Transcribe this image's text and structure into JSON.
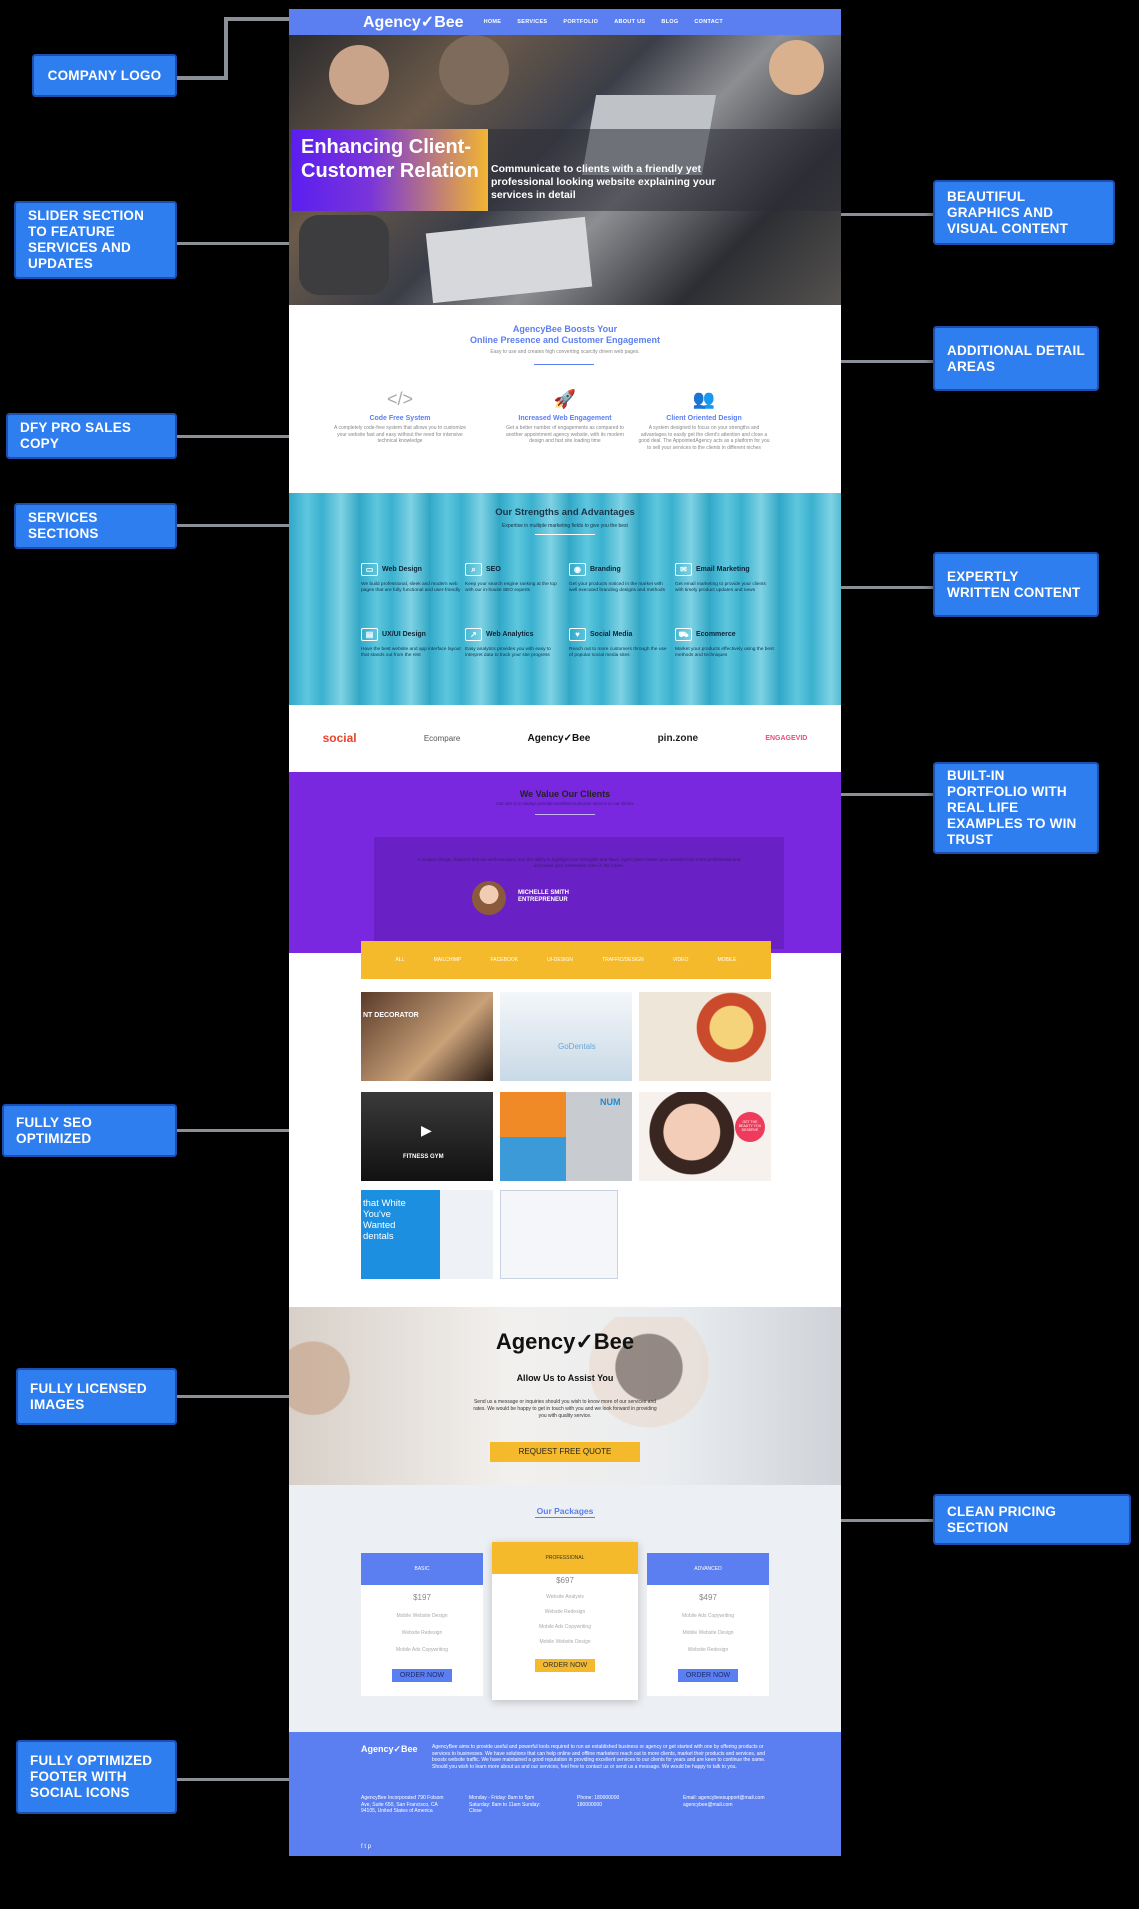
{
  "callouts": {
    "company_logo": "COMPANY LOGO",
    "slider": "SLIDER SECTION TO FEATURE SERVICES AND UPDATES",
    "dfy": "DFY PRO SALES COPY",
    "services": "SERVICES SECTIONS",
    "seo": "FULLY SEO OPTIMIZED",
    "images": "FULLY LICENSED IMAGES",
    "footer": "FULLY OPTIMIZED FOOTER WITH SOCIAL ICONS",
    "graphics": "BEAUTIFUL GRAPHICS AND VISUAL CONTENT",
    "detail": "ADDITIONAL DETAIL AREAS",
    "content": "EXPERTLY WRITTEN CONTENT",
    "portfolio": "BUILT-IN PORTFOLIO WITH REAL LIFE EXAMPLES TO WIN TRUST",
    "pricing": "CLEAN PRICING SECTION"
  },
  "nav": {
    "logo": "Agency✓Bee",
    "links": [
      "HOME",
      "SERVICES",
      "PORTFOLIO",
      "ABOUT US",
      "BLOG",
      "CONTACT"
    ]
  },
  "hero": {
    "title": "Enhancing Client-Customer Relation",
    "subtitle": "Communicate to clients with a friendly yet professional looking website explaining your services in detail"
  },
  "intro": {
    "title1": "AgencyBee Boosts Your",
    "title2": "Online Presence and Customer Engagement",
    "sub": "Easy to use and creates high converting scarcity driven web pages.",
    "features": [
      {
        "icon": "</>",
        "title": "Code Free System",
        "desc": "A completely code-free system that allows you to customize your website fast and easy without the need for intensive technical knowledge"
      },
      {
        "icon": "🚀",
        "title": "Increased Web Engagement",
        "desc": "Get a better number of engagements as compared to another appointment agency website, with its modern design and fast site loading time"
      },
      {
        "icon": "👥",
        "title": "Client Oriented Design",
        "desc": "A system designed to focus on your strengths and advantages to easily get the client's attention and close a good deal. The AppointedAgency acts as a platform for you to sell your services to the clients in different niches"
      }
    ]
  },
  "strengths": {
    "title": "Our Strengths and Advantages",
    "sub": "Expertise in multiple marketing fields to give you the best",
    "items": [
      {
        "title": "Web Design",
        "desc": "We build professional, sleek and modern web pages that are fully functional and user-friendly"
      },
      {
        "title": "SEO",
        "desc": "Keep your search engine ranking at the top with our in-house SEO experts"
      },
      {
        "title": "Branding",
        "desc": "Get your products noticed in the market with well executed branding designs and methods"
      },
      {
        "title": "Email Marketing",
        "desc": "Get email marketing to provide your clients with timely product updates and news"
      },
      {
        "title": "UX/UI Design",
        "desc": "Have the best website and app interface layout that stands out from the rest"
      },
      {
        "title": "Web Analytics",
        "desc": "Easy analytics provides you with easy to interpret data to track your site progress"
      },
      {
        "title": "Social Media",
        "desc": "Reach out to more customers through the use of popular social media sites"
      },
      {
        "title": "Ecommerce",
        "desc": "Market your products effectively using the best methods and techniques"
      }
    ]
  },
  "brands": [
    "social",
    "Ecompare",
    "Agency✓Bee",
    "pin.zone",
    "ENGAGEVID"
  ],
  "clients": {
    "title": "We Value Our Clients",
    "sub": "Our aim is to always provide excellent customer service to our clients",
    "quote": "A modern design, features that are well-executed, and the ability to highlight your strengths and flaws. AgencyBee makes your website look more professional and increases your conversion rates in the future.",
    "name": "MICHELLE SMITH",
    "role": "ENTREPRENEUR"
  },
  "portfolio": {
    "tabs": [
      "ALL",
      "MAILCHIMP",
      "FACEBOOK",
      "UI-DESIGN",
      "TRAFFIC/DESIGN",
      "VIDEO",
      "MOBILE"
    ],
    "thumbs": [
      "NT DECORATOR",
      "GoDentals",
      "",
      "FITNESS GYM",
      "NUM",
      "GET THE BEAUTY YOU DESERVE",
      "that White You've Wanted dentals",
      ""
    ]
  },
  "cta": {
    "logo": "Agency✓Bee",
    "title": "Allow Us to Assist You",
    "text": "Send us a message or inquiries should you wish to know more of our services and rates. We would be happy to get in touch with you and we look forward in providing you with quality service.",
    "button": "REQUEST FREE QUOTE"
  },
  "packages": {
    "title": "Our Packages",
    "cards": [
      {
        "name": "BASIC",
        "price": "$197",
        "features": [
          "Mobile Website Design",
          "Website Redesign",
          "Mobile Ads Copywriting"
        ],
        "button": "ORDER NOW"
      },
      {
        "name": "PROFESSIONAL",
        "price": "$697",
        "features": [
          "Website Analysis",
          "Website Redesign",
          "Mobile Ads Copywriting",
          "Mobile Website Design"
        ],
        "button": "ORDER NOW"
      },
      {
        "name": "ADVANCED",
        "price": "$497",
        "features": [
          "Mobile Ads Copywriting",
          "Mobile Website Design",
          "Website Redesign"
        ],
        "button": "ORDER NOW"
      }
    ]
  },
  "footer": {
    "logo": "Agency✓Bee",
    "about": "AgencyBee aims to provide useful and powerful tools required to run an established business or agency or get started with one by offering products or services to businesses. We have solutions that can help online and offline marketers reach out to more clients, market their products and services, and boosts website traffic. We have maintained a good reputation in providing excellent services to our clients for years and are keen to continue the same. Should you wish to learn more about us and our services, feel free to contact us or send us a message. We would be happy to talk to you.",
    "address": "AgencyBee Incorporated 790 Folsom Ave, Suite 650, San Francisco, CA 94105, United States of America",
    "hours": "Monday - Friday: 8am to 5pm Saturday: 8am to 11am Sunday: Close",
    "phone": "Phone: 180000000 180000000",
    "email": "Email: agencybeesupport@mail.com agencybee@mail.com",
    "social": "f  t  p"
  },
  "colors": {
    "accent": "#5b7ff0",
    "purple": "#7a27e0",
    "yellow": "#f4ba2c",
    "callout": "#2f7ef0"
  }
}
